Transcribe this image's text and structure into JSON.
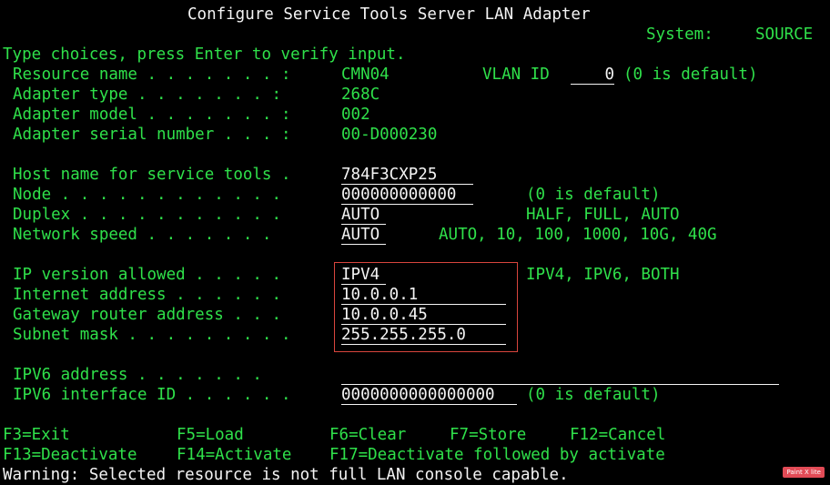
{
  "header": {
    "title": "Configure Service Tools Server LAN Adapter",
    "system_label": "System:",
    "system_value": "SOURCE",
    "instructions": "Type choices, press Enter to verify input."
  },
  "adapter": {
    "resource_name": {
      "label": "Resource name . . . . . . . :",
      "value": "CMN04"
    },
    "vlan_id": {
      "label": "VLAN ID",
      "value": "0",
      "hint": "(0 is default)"
    },
    "adapter_type": {
      "label": "Adapter type . . . . . . . :",
      "value": "268C"
    },
    "adapter_model": {
      "label": "Adapter model . . . . . . . :",
      "value": "002"
    },
    "adapter_serial": {
      "label": "Adapter serial number . . . :",
      "value": "00-D000230"
    }
  },
  "service": {
    "host_name": {
      "label": "Host name for service tools .",
      "value": "784F3CXP25"
    },
    "node": {
      "label": "Node . . . . . . . . . . . .",
      "value": "000000000000",
      "hint": "(0 is default)"
    },
    "duplex": {
      "label": "Duplex . . . . . . . . . . .",
      "value": "AUTO",
      "hint": "HALF, FULL, AUTO"
    },
    "network_speed": {
      "label": "Network speed . . . . . . .",
      "value": "AUTO",
      "hint": "AUTO, 10, 100, 1000, 10G, 40G"
    }
  },
  "ipv4": {
    "ip_version": {
      "label": "IP version allowed . . . . .",
      "value": "IPV4",
      "hint": "IPV4, IPV6, BOTH"
    },
    "internet_address": {
      "label": "Internet address . . . . . .",
      "value": "10.0.0.1"
    },
    "gateway": {
      "label": "Gateway router address . . .",
      "value": "10.0.0.45"
    },
    "subnet": {
      "label": "Subnet mask . . . . . . . . .",
      "value": "255.255.255.0"
    }
  },
  "ipv6": {
    "address": {
      "label": "IPV6 address . . . . . . .",
      "value": ""
    },
    "interface_id": {
      "label": "IPV6 interface ID . . . . . .",
      "value": "0000000000000000",
      "hint": "(0 is default)"
    }
  },
  "function_keys": {
    "f3": "F3=Exit",
    "f5": "F5=Load",
    "f6": "F6=Clear",
    "f7": "F7=Store",
    "f12": "F12=Cancel",
    "f13": "F13=Deactivate",
    "f14": "F14=Activate",
    "f17": "F17=Deactivate followed by activate"
  },
  "message": "Warning: Selected resource is not full LAN console capable.",
  "badge": "Paint X lite",
  "colors": {
    "background": "#000000",
    "text_green": "#2fe04a",
    "text_white": "#f4f4f4",
    "highlight_box": "#d9453d"
  }
}
